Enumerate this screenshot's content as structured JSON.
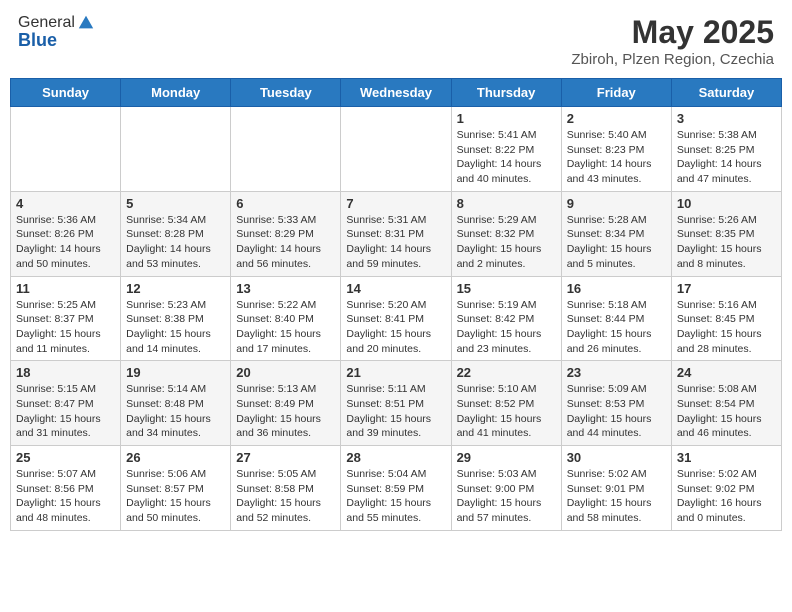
{
  "header": {
    "logo_line1": "General",
    "logo_line2": "Blue",
    "title": "May 2025",
    "subtitle": "Zbiroh, Plzen Region, Czechia"
  },
  "calendar": {
    "days_of_week": [
      "Sunday",
      "Monday",
      "Tuesday",
      "Wednesday",
      "Thursday",
      "Friday",
      "Saturday"
    ],
    "weeks": [
      [
        {
          "day": "",
          "info": ""
        },
        {
          "day": "",
          "info": ""
        },
        {
          "day": "",
          "info": ""
        },
        {
          "day": "",
          "info": ""
        },
        {
          "day": "1",
          "info": "Sunrise: 5:41 AM\nSunset: 8:22 PM\nDaylight: 14 hours\nand 40 minutes."
        },
        {
          "day": "2",
          "info": "Sunrise: 5:40 AM\nSunset: 8:23 PM\nDaylight: 14 hours\nand 43 minutes."
        },
        {
          "day": "3",
          "info": "Sunrise: 5:38 AM\nSunset: 8:25 PM\nDaylight: 14 hours\nand 47 minutes."
        }
      ],
      [
        {
          "day": "4",
          "info": "Sunrise: 5:36 AM\nSunset: 8:26 PM\nDaylight: 14 hours\nand 50 minutes."
        },
        {
          "day": "5",
          "info": "Sunrise: 5:34 AM\nSunset: 8:28 PM\nDaylight: 14 hours\nand 53 minutes."
        },
        {
          "day": "6",
          "info": "Sunrise: 5:33 AM\nSunset: 8:29 PM\nDaylight: 14 hours\nand 56 minutes."
        },
        {
          "day": "7",
          "info": "Sunrise: 5:31 AM\nSunset: 8:31 PM\nDaylight: 14 hours\nand 59 minutes."
        },
        {
          "day": "8",
          "info": "Sunrise: 5:29 AM\nSunset: 8:32 PM\nDaylight: 15 hours\nand 2 minutes."
        },
        {
          "day": "9",
          "info": "Sunrise: 5:28 AM\nSunset: 8:34 PM\nDaylight: 15 hours\nand 5 minutes."
        },
        {
          "day": "10",
          "info": "Sunrise: 5:26 AM\nSunset: 8:35 PM\nDaylight: 15 hours\nand 8 minutes."
        }
      ],
      [
        {
          "day": "11",
          "info": "Sunrise: 5:25 AM\nSunset: 8:37 PM\nDaylight: 15 hours\nand 11 minutes."
        },
        {
          "day": "12",
          "info": "Sunrise: 5:23 AM\nSunset: 8:38 PM\nDaylight: 15 hours\nand 14 minutes."
        },
        {
          "day": "13",
          "info": "Sunrise: 5:22 AM\nSunset: 8:40 PM\nDaylight: 15 hours\nand 17 minutes."
        },
        {
          "day": "14",
          "info": "Sunrise: 5:20 AM\nSunset: 8:41 PM\nDaylight: 15 hours\nand 20 minutes."
        },
        {
          "day": "15",
          "info": "Sunrise: 5:19 AM\nSunset: 8:42 PM\nDaylight: 15 hours\nand 23 minutes."
        },
        {
          "day": "16",
          "info": "Sunrise: 5:18 AM\nSunset: 8:44 PM\nDaylight: 15 hours\nand 26 minutes."
        },
        {
          "day": "17",
          "info": "Sunrise: 5:16 AM\nSunset: 8:45 PM\nDaylight: 15 hours\nand 28 minutes."
        }
      ],
      [
        {
          "day": "18",
          "info": "Sunrise: 5:15 AM\nSunset: 8:47 PM\nDaylight: 15 hours\nand 31 minutes."
        },
        {
          "day": "19",
          "info": "Sunrise: 5:14 AM\nSunset: 8:48 PM\nDaylight: 15 hours\nand 34 minutes."
        },
        {
          "day": "20",
          "info": "Sunrise: 5:13 AM\nSunset: 8:49 PM\nDaylight: 15 hours\nand 36 minutes."
        },
        {
          "day": "21",
          "info": "Sunrise: 5:11 AM\nSunset: 8:51 PM\nDaylight: 15 hours\nand 39 minutes."
        },
        {
          "day": "22",
          "info": "Sunrise: 5:10 AM\nSunset: 8:52 PM\nDaylight: 15 hours\nand 41 minutes."
        },
        {
          "day": "23",
          "info": "Sunrise: 5:09 AM\nSunset: 8:53 PM\nDaylight: 15 hours\nand 44 minutes."
        },
        {
          "day": "24",
          "info": "Sunrise: 5:08 AM\nSunset: 8:54 PM\nDaylight: 15 hours\nand 46 minutes."
        }
      ],
      [
        {
          "day": "25",
          "info": "Sunrise: 5:07 AM\nSunset: 8:56 PM\nDaylight: 15 hours\nand 48 minutes."
        },
        {
          "day": "26",
          "info": "Sunrise: 5:06 AM\nSunset: 8:57 PM\nDaylight: 15 hours\nand 50 minutes."
        },
        {
          "day": "27",
          "info": "Sunrise: 5:05 AM\nSunset: 8:58 PM\nDaylight: 15 hours\nand 52 minutes."
        },
        {
          "day": "28",
          "info": "Sunrise: 5:04 AM\nSunset: 8:59 PM\nDaylight: 15 hours\nand 55 minutes."
        },
        {
          "day": "29",
          "info": "Sunrise: 5:03 AM\nSunset: 9:00 PM\nDaylight: 15 hours\nand 57 minutes."
        },
        {
          "day": "30",
          "info": "Sunrise: 5:02 AM\nSunset: 9:01 PM\nDaylight: 15 hours\nand 58 minutes."
        },
        {
          "day": "31",
          "info": "Sunrise: 5:02 AM\nSunset: 9:02 PM\nDaylight: 16 hours\nand 0 minutes."
        }
      ]
    ]
  }
}
